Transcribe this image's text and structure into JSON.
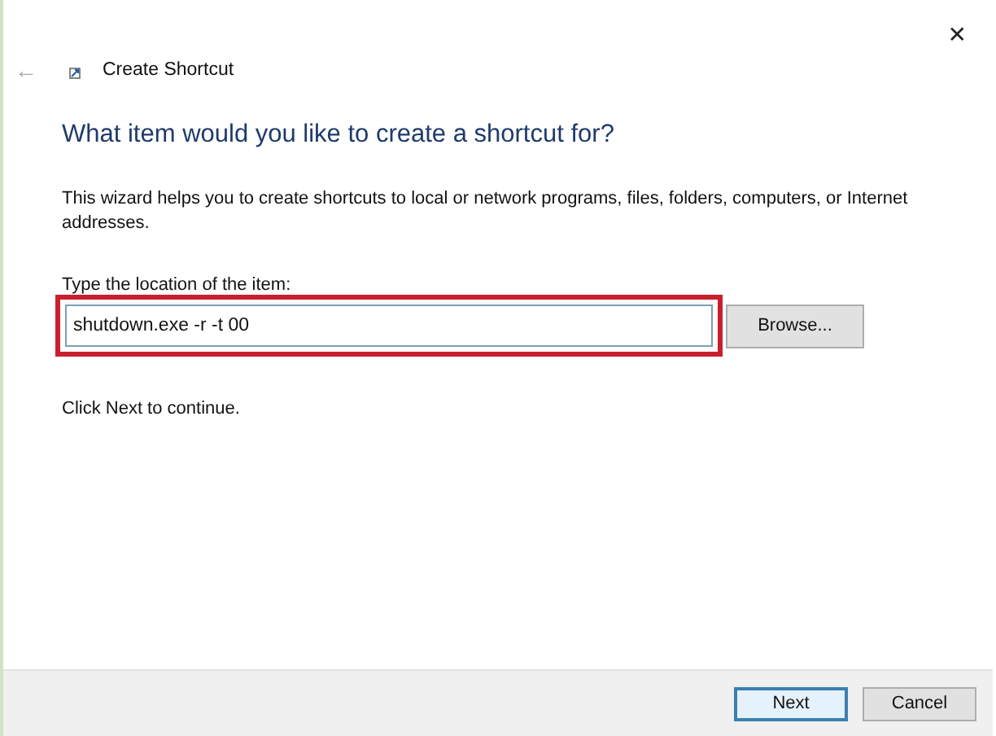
{
  "window": {
    "title": "Create Shortcut",
    "close": "✕",
    "back": "←"
  },
  "heading": "What item would you like to create a shortcut for?",
  "description": "This wizard helps you to create shortcuts to local or network programs, files, folders, computers, or Internet addresses.",
  "location": {
    "label": "Type the location of the item:",
    "value": "shutdown.exe -r -t 00",
    "highlighted": true
  },
  "browse_button": "Browse...",
  "hint": "Click Next to continue.",
  "buttons": [
    {
      "label": "Next",
      "default": true
    },
    {
      "label": "Cancel",
      "default": false
    }
  ]
}
